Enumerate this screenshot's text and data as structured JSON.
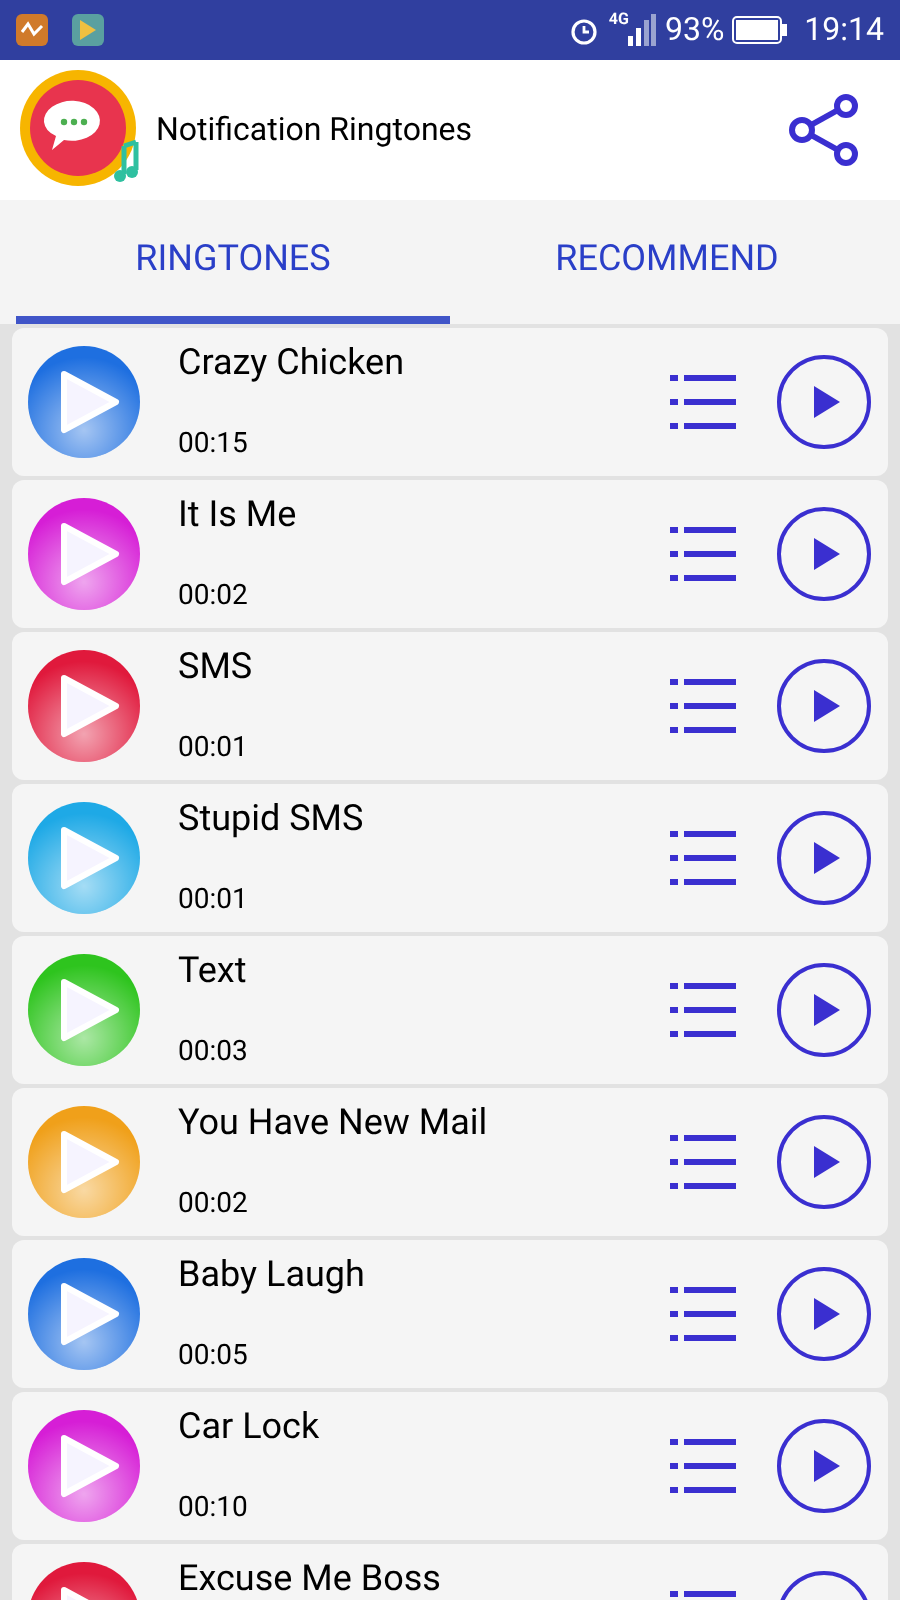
{
  "status_bar": {
    "network": "4G",
    "battery": "93%",
    "time": "19:14"
  },
  "app_bar": {
    "title": "Notification Ringtones"
  },
  "tabs": [
    {
      "label": "RINGTONES",
      "selected": true
    },
    {
      "label": "RECOMMEND",
      "selected": false
    }
  ],
  "ringtones": [
    {
      "name": "Crazy Chicken",
      "duration": "00:15",
      "color": "#1e6fe0"
    },
    {
      "name": "It Is Me",
      "duration": "00:02",
      "color": "#d61ed6"
    },
    {
      "name": "SMS",
      "duration": "00:01",
      "color": "#e0193c"
    },
    {
      "name": "Stupid SMS",
      "duration": "00:01",
      "color": "#1ea9e6"
    },
    {
      "name": "Text",
      "duration": "00:03",
      "color": "#2ec41e"
    },
    {
      "name": "You Have New Mail",
      "duration": "00:02",
      "color": "#f0a01a"
    },
    {
      "name": "Baby Laugh",
      "duration": "00:05",
      "color": "#1e6fe0"
    },
    {
      "name": "Car Lock",
      "duration": "00:10",
      "color": "#d61ed6"
    },
    {
      "name": "Excuse Me Boss",
      "color": "#e0193c"
    }
  ]
}
